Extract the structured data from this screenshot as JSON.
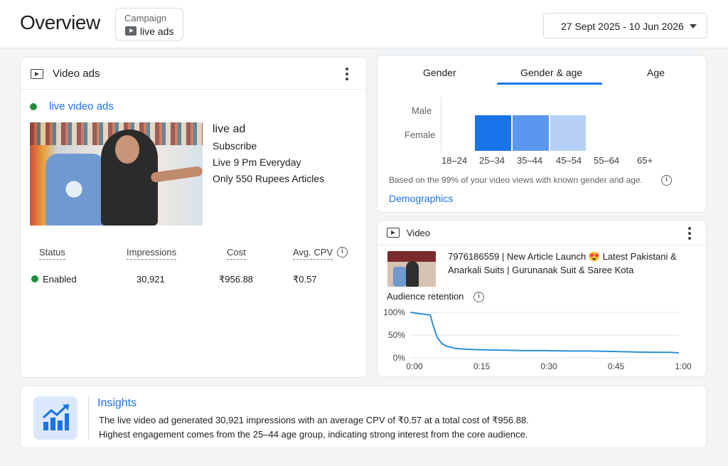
{
  "header": {
    "title": "Overview",
    "campaign_label": "Campaign",
    "campaign_value": "live ads",
    "date_range": "27 Sept 2025 - 10 Jun 2026"
  },
  "video_ads_card": {
    "title": "Video ads",
    "ad_name": "live video ads",
    "ad_title": "live ad",
    "ad_lines": [
      "Subscribe",
      "Live 9 Pm Everyday",
      "Only 550 Rupees Articles"
    ],
    "stats": {
      "headers": [
        "Status",
        "Impressions",
        "Cost",
        "Avg. CPV"
      ],
      "values": [
        "Enabled",
        "30,921",
        "₹956.88",
        "₹0.57"
      ]
    }
  },
  "demographics_card": {
    "tabs": [
      "Gender",
      "Gender & age",
      "Age"
    ],
    "active_tab": "Gender & age",
    "chart_data": {
      "type": "heatmap",
      "rows": [
        "Male",
        "Female"
      ],
      "columns": [
        "18–24",
        "25–34",
        "35–44",
        "45–54",
        "55–64",
        "65+"
      ],
      "highlighted": [
        "25–34",
        "35–44",
        "45–54"
      ],
      "colors": [
        "#1a73e8",
        "#5a97ee",
        "#b6d0f6"
      ]
    },
    "note": "Based on the 99% of your video views with known gender and age.",
    "link": "Demographics"
  },
  "video_card": {
    "title": "Video",
    "video_title": "7976186559 | New Article Launch 😍 Latest Pakistani & Anarkali Suits | Gurunanak Suit & Saree Kota",
    "retention_label": "Audience retention",
    "chart_data": {
      "type": "line",
      "y_ticks": [
        "100%",
        "50%",
        "0%"
      ],
      "x_ticks": [
        "0:00",
        "0:15",
        "0:30",
        "0:45",
        "1:00"
      ],
      "ylim": [
        0,
        100
      ],
      "series": [
        {
          "x": [
            0,
            2,
            4.5,
            5,
            6,
            7,
            8,
            10,
            12,
            15,
            20,
            25,
            30,
            35,
            40,
            45,
            50,
            55,
            58,
            60
          ],
          "values": [
            100,
            97,
            94,
            75,
            45,
            32,
            26,
            21,
            19,
            18,
            17,
            16,
            16,
            15,
            15,
            14,
            13,
            12,
            12,
            11
          ]
        }
      ]
    }
  },
  "insights": {
    "title": "Insights",
    "line1": "The live video ad generated 30,921 impressions with an average CPV of ₹0.57 at a total cost of ₹956.88.",
    "line2": "Highest engagement comes from the 25–44 age group, indicating strong interest from the core audience."
  }
}
